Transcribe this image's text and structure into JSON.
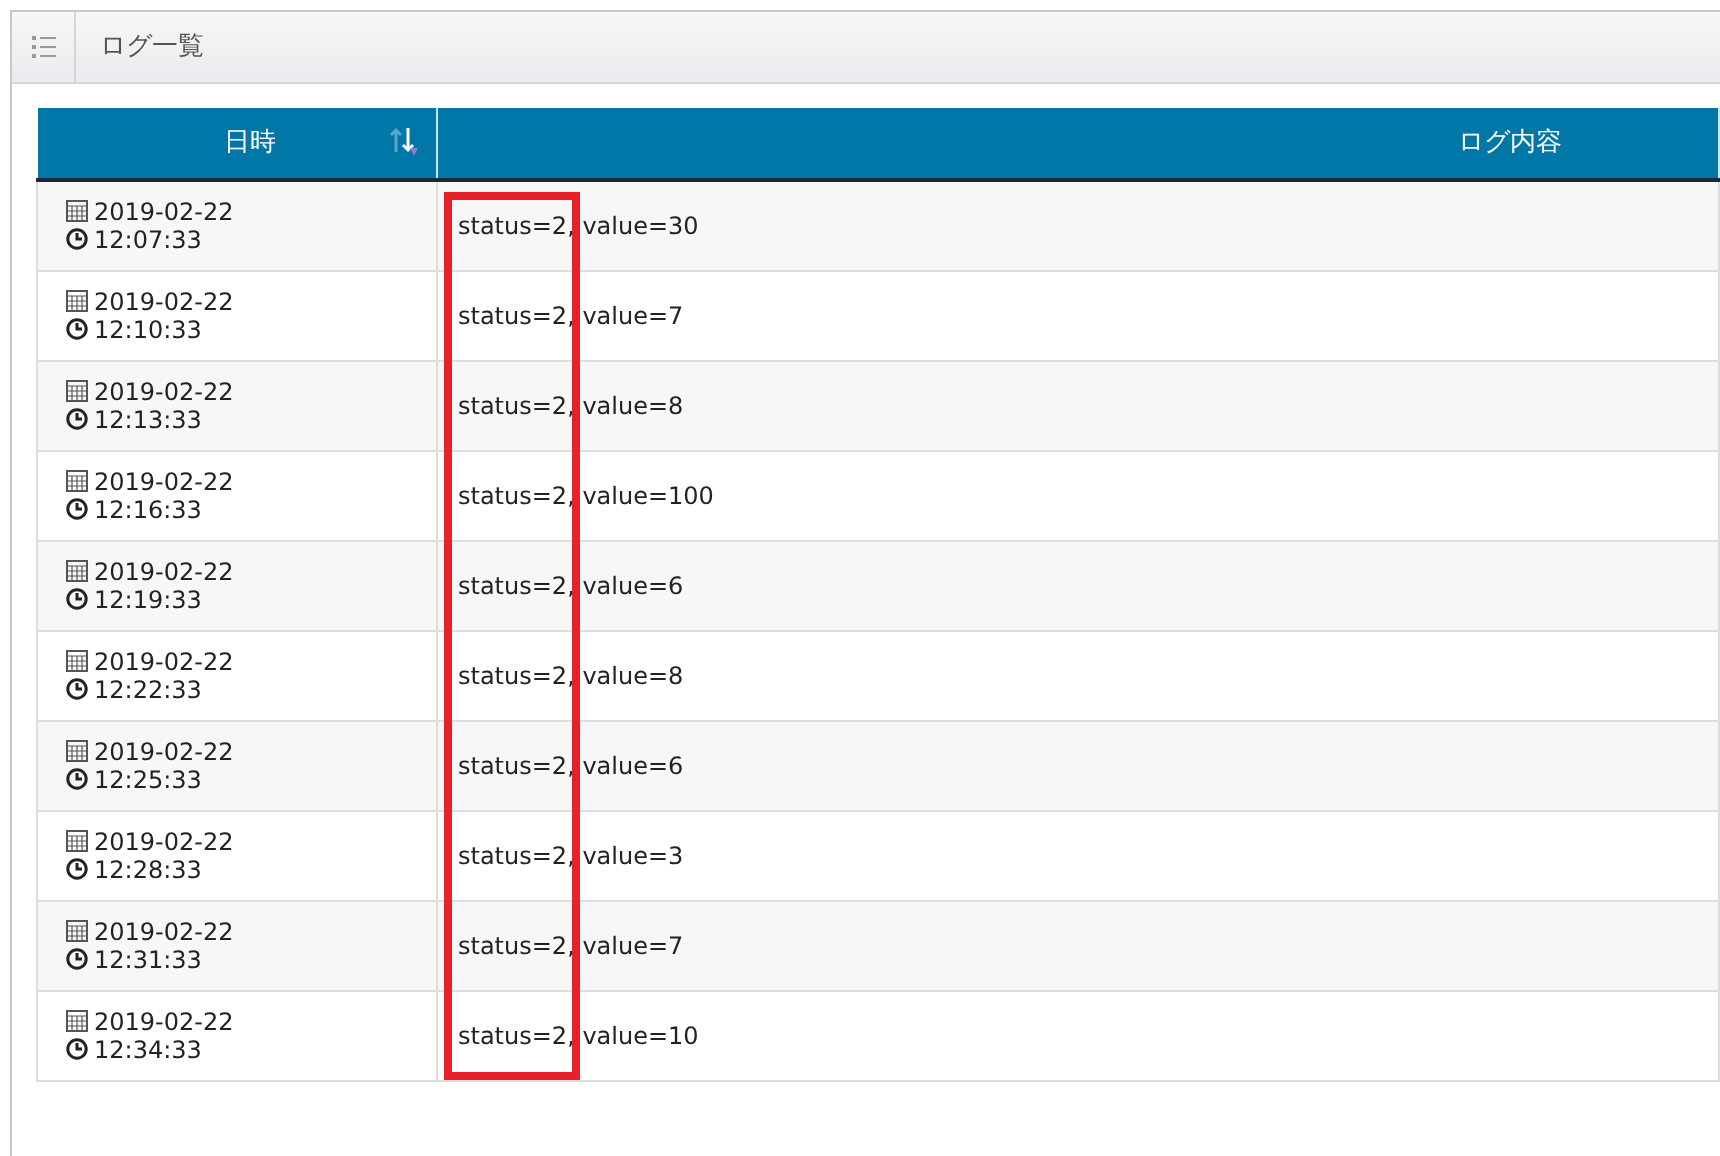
{
  "panel": {
    "title": "ログ一覧"
  },
  "table": {
    "columns": [
      {
        "label": "日時",
        "sortable": true
      },
      {
        "label": "ログ内容",
        "sortable": false
      }
    ],
    "rows": [
      {
        "date": "2019-02-22",
        "time": "12:07:33",
        "log": "status=2, value=30"
      },
      {
        "date": "2019-02-22",
        "time": "12:10:33",
        "log": "status=2, value=7"
      },
      {
        "date": "2019-02-22",
        "time": "12:13:33",
        "log": "status=2, value=8"
      },
      {
        "date": "2019-02-22",
        "time": "12:16:33",
        "log": "status=2, value=100"
      },
      {
        "date": "2019-02-22",
        "time": "12:19:33",
        "log": "status=2, value=6"
      },
      {
        "date": "2019-02-22",
        "time": "12:22:33",
        "log": "status=2, value=8"
      },
      {
        "date": "2019-02-22",
        "time": "12:25:33",
        "log": "status=2, value=6"
      },
      {
        "date": "2019-02-22",
        "time": "12:28:33",
        "log": "status=2, value=3"
      },
      {
        "date": "2019-02-22",
        "time": "12:31:33",
        "log": "status=2, value=7"
      },
      {
        "date": "2019-02-22",
        "time": "12:34:33",
        "log": "status=2, value=10"
      }
    ]
  },
  "annotation": {
    "kind": "highlight-box",
    "color": "#e8202a"
  }
}
